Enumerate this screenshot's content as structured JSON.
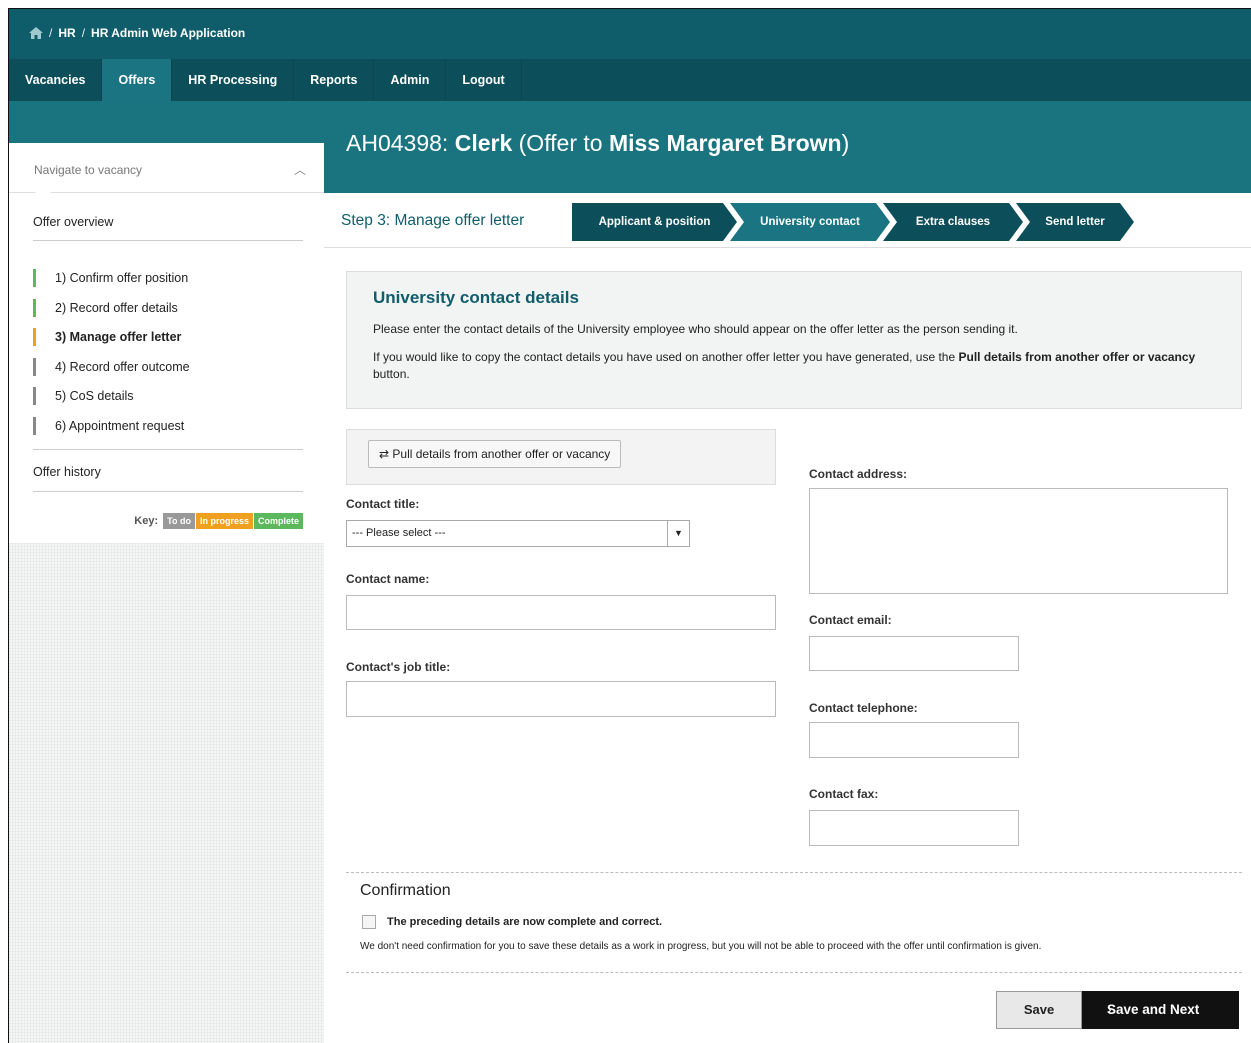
{
  "breadcrumb": {
    "home_icon": "home-icon",
    "items": [
      "HR",
      "HR Admin Web Application"
    ],
    "separator": "/"
  },
  "nav": [
    "Vacancies",
    "Offers",
    "HR Processing",
    "Reports",
    "Admin",
    "Logout"
  ],
  "nav_active": "Offers",
  "title": {
    "ref": "AH04398:",
    "position": "Clerk",
    "pre": "(Offer to",
    "name": "Miss Margaret Brown",
    "post": ")"
  },
  "sidebar": {
    "navigate_label": "Navigate to vacancy",
    "overview": "Offer overview",
    "steps": [
      {
        "label": "1) Confirm offer position",
        "status": "complete"
      },
      {
        "label": "2) Record offer details",
        "status": "complete"
      },
      {
        "label": "3) Manage offer letter",
        "status": "in progress"
      },
      {
        "label": "4) Record offer outcome",
        "status": "to do"
      },
      {
        "label": "5) CoS details",
        "status": "to do"
      },
      {
        "label": "6) Appointment request",
        "status": "to do"
      }
    ],
    "history": "Offer history",
    "key": {
      "label": "Key:",
      "todo": "To do",
      "progress": "In progress",
      "complete": "Complete"
    }
  },
  "step": {
    "prefix": "Step 3:",
    "label": "Manage offer letter",
    "tabs": [
      "Applicant & position",
      "University contact",
      "Extra clauses",
      "Send letter"
    ],
    "active_tab": "University contact"
  },
  "info": {
    "heading": "University contact details",
    "p1": "Please enter the contact details of the University employee who should appear on the offer letter as the person sending it.",
    "p2_pre": "If you would like to copy the contact details you have used on another offer letter you have generated, use the ",
    "p2_bold": "Pull details from another offer or vacancy",
    "p2_post": " button."
  },
  "pull_button": "Pull details from another offer or vacancy",
  "form": {
    "contact_title": {
      "label": "Contact title:",
      "value": "--- Please select ---"
    },
    "contact_name": {
      "label": "Contact name:",
      "value": ""
    },
    "job_title": {
      "label": "Contact's job title:",
      "value": ""
    },
    "address": {
      "label": "Contact address:",
      "value": ""
    },
    "email": {
      "label": "Contact email:",
      "value": ""
    },
    "telephone": {
      "label": "Contact telephone:",
      "value": ""
    },
    "fax": {
      "label": "Contact fax:",
      "value": ""
    }
  },
  "confirmation": {
    "heading": "Confirmation",
    "checkbox_label": "The preceding details are now complete and correct.",
    "checked": false,
    "note": "We don't need confirmation for you to save these details as a work in progress, but you will not be able to proceed with the offer until confirmation is given."
  },
  "buttons": {
    "save": "Save",
    "save_next": "Save and Next"
  },
  "colors": {
    "brand_dark": "#0c4f5a",
    "brand": "#1a7480",
    "complete": "#5cb85c",
    "in_progress": "#f0a020",
    "todo": "#999999"
  }
}
